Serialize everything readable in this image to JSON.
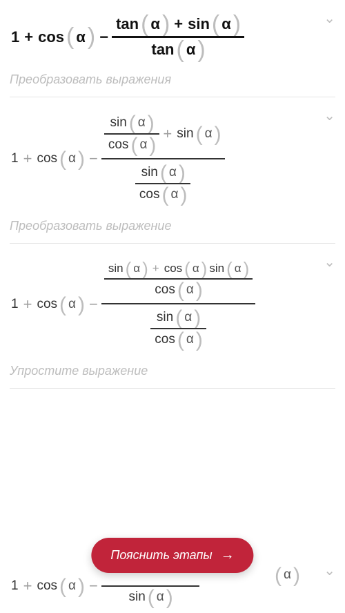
{
  "hints": {
    "h1": "Преобразовать выражения",
    "h2": "Преобразовать выражение",
    "h3": "Упростите выражение"
  },
  "fn": {
    "tan": "tan",
    "sin": "sin",
    "cos": "cos"
  },
  "sym": {
    "one": "1",
    "plus": "+",
    "minus": "−",
    "a": "α",
    "lp": "(",
    "rp": ")"
  },
  "pill": {
    "label": "Пояснить этапы",
    "arrow": "→"
  },
  "chev": "⌄"
}
